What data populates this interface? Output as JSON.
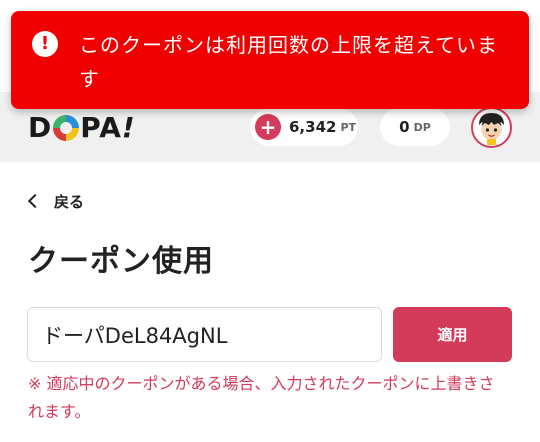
{
  "toast": {
    "icon": "alert-circle-icon",
    "message": "このクーポンは利用回数の上限を超えています",
    "color": "#f00000"
  },
  "header": {
    "logo_text": "DOPA!",
    "points": {
      "value": "6,342",
      "unit": "PT",
      "icon": "plus-icon"
    },
    "dopa_points": {
      "value": "0",
      "unit": "DP"
    },
    "avatar": "avatar-icon"
  },
  "nav": {
    "back_label": "戻る",
    "back_icon": "chevron-left-icon"
  },
  "page": {
    "title": "クーポン使用"
  },
  "coupon": {
    "input_value": "ドーパDeL84AgNL",
    "apply_label": "適用",
    "notice": "※ 適応中のクーポンがある場合、入力されたクーポンに上書きされます。"
  },
  "colors": {
    "accent": "#d43a5a",
    "header_bg": "#f0f0f0"
  }
}
